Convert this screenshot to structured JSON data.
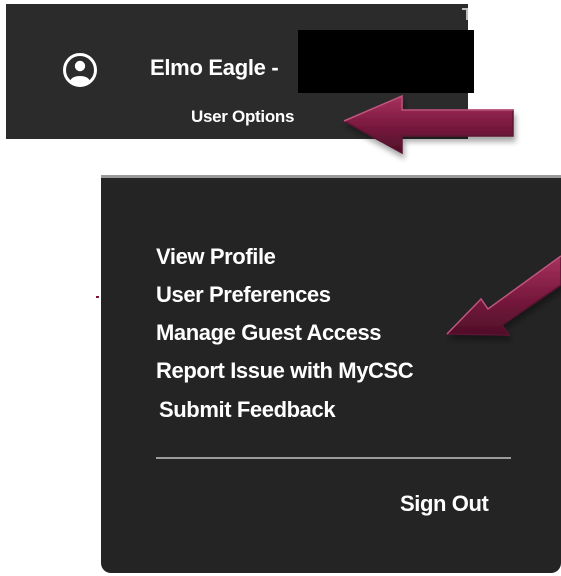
{
  "header": {
    "user_name": "Elmo Eagle -",
    "user_options_label": "User Options",
    "avatar_icon": "user-circle-icon",
    "background": "#2b2b2b"
  },
  "menu": {
    "items": [
      {
        "label": "View Profile"
      },
      {
        "label": "User Preferences"
      },
      {
        "label": "Manage Guest Access"
      },
      {
        "label": "Report Issue with MyCSC"
      },
      {
        "label": "Submit Feedback"
      }
    ],
    "sign_out_label": "Sign Out",
    "background": "#242424"
  },
  "annotations": {
    "arrow_color": "#7b1a3f",
    "arrow_icons": [
      "arrow-to-user-options-icon",
      "arrow-to-manage-guest-access-icon"
    ]
  }
}
